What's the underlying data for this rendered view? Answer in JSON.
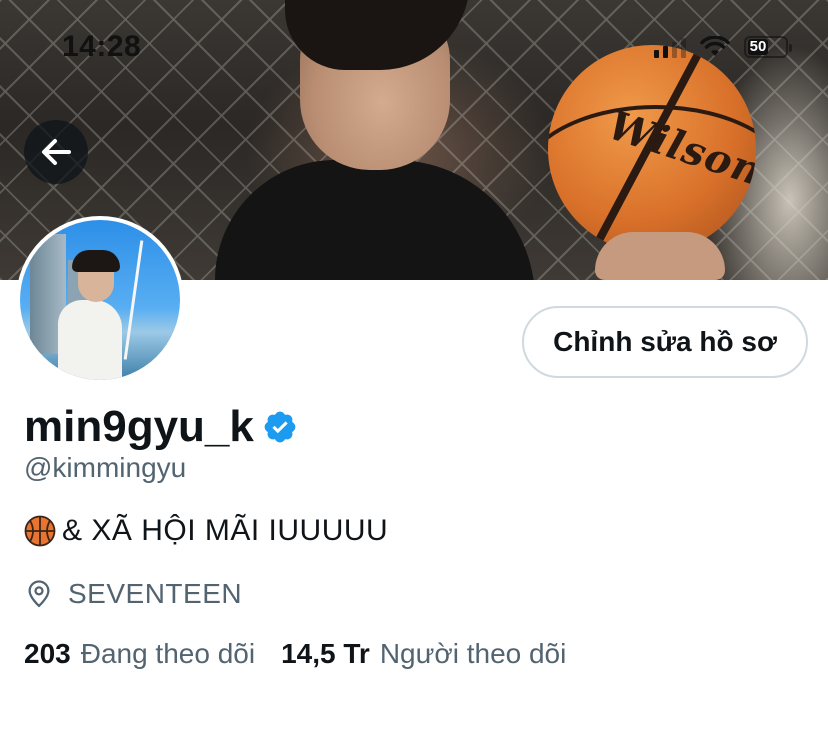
{
  "status_bar": {
    "time": "14:28",
    "battery": "50"
  },
  "header": {
    "banner_description": "",
    "ball_brand": "Wilson"
  },
  "profile": {
    "edit_button_label": "Chỉnh sửa hồ sơ",
    "display_name": "min9gyu_k",
    "verified": true,
    "handle": "@kimmingyu",
    "bio_emoji": "🏀",
    "bio_text": "& XÃ HỘI MÃI IUUUUU",
    "location": "SEVENTEEN",
    "following_count": "203",
    "following_label": "Đang theo dõi",
    "followers_count": "14,5 Tr",
    "followers_label": "Người theo dõi"
  },
  "colors": {
    "text_primary": "#0f1419",
    "text_secondary": "#536471",
    "verified_blue": "#1d9bf0",
    "button_border": "#cfd9de"
  },
  "icons": {
    "back": "arrow-left-icon",
    "verified": "verified-badge-icon",
    "location": "location-pin-icon",
    "basketball": "basketball-emoji-icon"
  }
}
